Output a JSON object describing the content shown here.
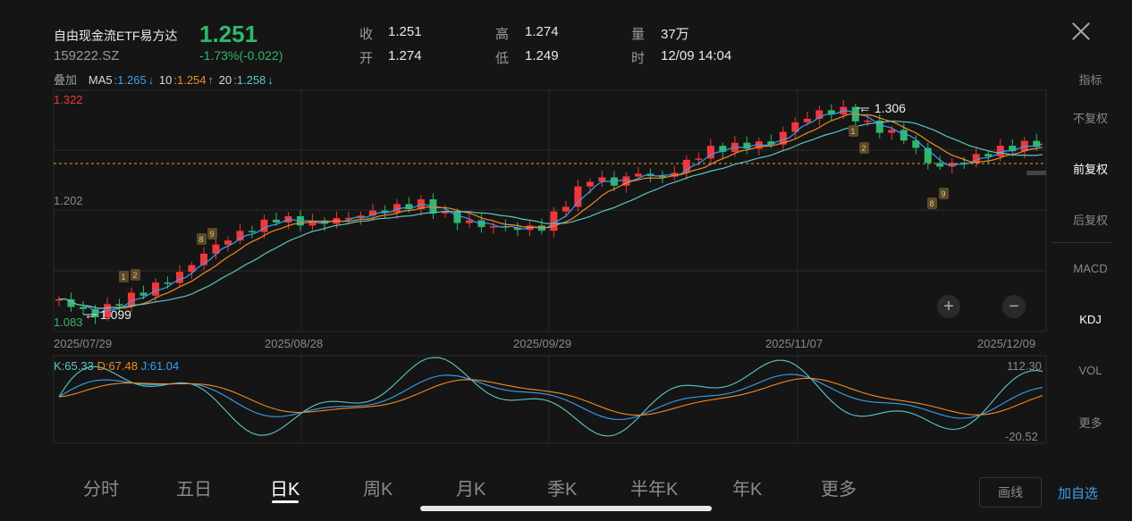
{
  "header": {
    "name": "自由现金流ETF易方达",
    "code": "159222.SZ",
    "price": "1.251",
    "change": "-1.73%(-0.022)",
    "stats": [
      {
        "label": "收",
        "value": "1.251"
      },
      {
        "label": "高",
        "value": "1.274"
      },
      {
        "label": "量",
        "value": "37万"
      },
      {
        "label": "开",
        "value": "1.274"
      },
      {
        "label": "低",
        "value": "1.249"
      },
      {
        "label": "时",
        "value": "12/09 14:04"
      }
    ]
  },
  "ma_bar": {
    "overlay": "叠加",
    "ma5_label": "MA5",
    "ma5_value": "1.265",
    "ma5_arrow": "↓",
    "ma10_label": "10",
    "ma10_value": "1.254",
    "ma10_arrow": "↑",
    "ma20_label": "20",
    "ma20_value": "1.258",
    "ma20_arrow": "↓"
  },
  "sidebar": {
    "header": "指标",
    "items": [
      "不复权",
      "前复权",
      "后复权",
      "MACD",
      "KDJ",
      "VOL",
      "更多"
    ],
    "active": [
      "前复权",
      "KDJ"
    ]
  },
  "main_chart": {
    "y_top": "1.322",
    "y_mid": "1.202",
    "y_bottom": "1.083",
    "high_annotation": "1.306",
    "low_annotation": "1.099",
    "dates": [
      "2025/07/29",
      "2025/08/28",
      "2025/09/29",
      "2025/11/07",
      "2025/12/09"
    ],
    "zoom_in": "+",
    "zoom_out": "−",
    "markers": [
      "1",
      "2",
      "8",
      "9",
      "1",
      "2",
      "8",
      "9"
    ]
  },
  "kdj": {
    "k": "K:65.33",
    "d": "D:67.48",
    "j": "J:61.04",
    "y_top": "112.30",
    "y_bottom": "-20.52"
  },
  "tabs": [
    "分时",
    "五日",
    "日K",
    "周K",
    "月K",
    "季K",
    "半年K",
    "年K",
    "更多"
  ],
  "active_tab": "日K",
  "bottom": {
    "draw": "画线",
    "add_watch": "加自选"
  },
  "colors": {
    "up": "#f0383c",
    "down": "#2fb86b",
    "ma5": "#3a9ff0",
    "ma10": "#f08a24",
    "ma20": "#5ec6c6"
  }
}
